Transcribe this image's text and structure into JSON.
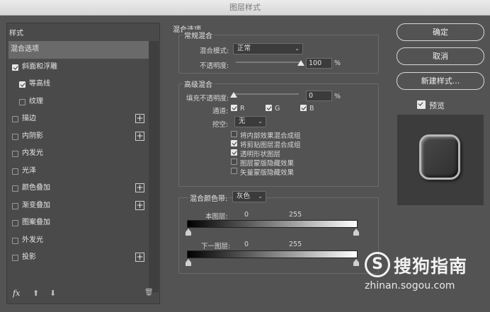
{
  "window": {
    "title": "图层样式"
  },
  "left": {
    "header": "样式",
    "items": [
      {
        "label": "混合选项",
        "checkbox": false,
        "checked": false,
        "plus": false,
        "active": true,
        "indent": 0
      },
      {
        "label": "斜面和浮雕",
        "checkbox": true,
        "checked": true,
        "plus": false,
        "active": false,
        "indent": 0
      },
      {
        "label": "等高线",
        "checkbox": true,
        "checked": true,
        "plus": false,
        "active": false,
        "indent": 1
      },
      {
        "label": "纹理",
        "checkbox": true,
        "checked": false,
        "plus": false,
        "active": false,
        "indent": 1
      },
      {
        "label": "描边",
        "checkbox": true,
        "checked": false,
        "plus": true,
        "active": false,
        "indent": 0
      },
      {
        "label": "内阴影",
        "checkbox": true,
        "checked": false,
        "plus": true,
        "active": false,
        "indent": 0
      },
      {
        "label": "内发光",
        "checkbox": true,
        "checked": false,
        "plus": false,
        "active": false,
        "indent": 0
      },
      {
        "label": "光泽",
        "checkbox": true,
        "checked": false,
        "plus": false,
        "active": false,
        "indent": 0
      },
      {
        "label": "颜色叠加",
        "checkbox": true,
        "checked": false,
        "plus": true,
        "active": false,
        "indent": 0
      },
      {
        "label": "渐变叠加",
        "checkbox": true,
        "checked": false,
        "plus": true,
        "active": false,
        "indent": 0
      },
      {
        "label": "图案叠加",
        "checkbox": true,
        "checked": false,
        "plus": false,
        "active": false,
        "indent": 0
      },
      {
        "label": "外发光",
        "checkbox": true,
        "checked": false,
        "plus": false,
        "active": false,
        "indent": 0
      },
      {
        "label": "投影",
        "checkbox": true,
        "checked": false,
        "plus": true,
        "active": false,
        "indent": 0
      }
    ],
    "footer": {
      "fx": "fx",
      "up": "⬆",
      "down": "⬇",
      "trash": "🗑"
    }
  },
  "blend": {
    "title": "混合选项",
    "general": {
      "legend": "常规混合",
      "mode_label": "混合模式:",
      "mode_value": "正常",
      "opacity_label": "不透明度:",
      "opacity_value": "100",
      "opacity_unit": "%",
      "opacity_fraction": 1.0
    },
    "advanced": {
      "legend": "高级混合",
      "fill_label": "填充不透明度:",
      "fill_value": "0",
      "fill_unit": "%",
      "fill_fraction": 0.0,
      "channels_label": "通道:",
      "channels": [
        {
          "label": "R",
          "checked": true
        },
        {
          "label": "G",
          "checked": true
        },
        {
          "label": "B",
          "checked": true
        }
      ],
      "knockout_label": "挖空:",
      "knockout_value": "无",
      "options": [
        {
          "label": "将内部效果混合成组",
          "checked": false
        },
        {
          "label": "将剪贴图层混合成组",
          "checked": true
        },
        {
          "label": "透明形状图层",
          "checked": true
        },
        {
          "label": "图层蒙版隐藏效果",
          "checked": false
        },
        {
          "label": "矢量蒙版隐藏效果",
          "checked": false
        }
      ]
    },
    "blend_if": {
      "label": "混合颜色带:",
      "value": "灰色",
      "this_layer": {
        "label": "本图层:",
        "low": "0",
        "high": "255"
      },
      "under_layer": {
        "label": "下一图层:",
        "low": "0",
        "high": "255"
      }
    }
  },
  "buttons": {
    "ok": "确定",
    "cancel": "取消",
    "new_style": "新建样式...",
    "preview_label": "预览",
    "preview_checked": true
  },
  "watermark": {
    "brand": "搜狗指南",
    "logo_letter": "S",
    "url": "zhinan.sogou.com"
  }
}
